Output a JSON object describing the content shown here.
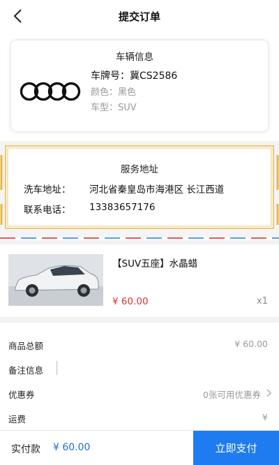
{
  "header": {
    "title": "提交订单"
  },
  "vehicle": {
    "section_title": "车辆信息",
    "plate": "车牌号：冀CS2586",
    "color": "颜色：黑色",
    "type": "车型：SUV"
  },
  "service": {
    "section_title": "服务地址",
    "address_label": "洗车地址：",
    "address_value": "河北省秦皇岛市海港区 长江西道",
    "phone_label": "联系电话：",
    "phone_value": "13383657176"
  },
  "product": {
    "name": "【SUV五座】水晶蜡",
    "price": "¥ 60.00",
    "quantity": "x1"
  },
  "summary": {
    "goods_total_label": "商品总额",
    "goods_total_value": "¥ 60.00",
    "remark_label": "备注信息",
    "coupon_label": "优惠券",
    "coupon_value": "0张可用优惠券",
    "shipping_label": "运费",
    "shipping_value": "¥"
  },
  "footer": {
    "paid_label": "实付款",
    "paid_amount": "¥ 60.00",
    "pay_button": "立即支付"
  },
  "colors": {
    "accent_blue": "#1f7cf0",
    "price_red": "#e0302f",
    "stamp_gold": "#e8b84a"
  }
}
